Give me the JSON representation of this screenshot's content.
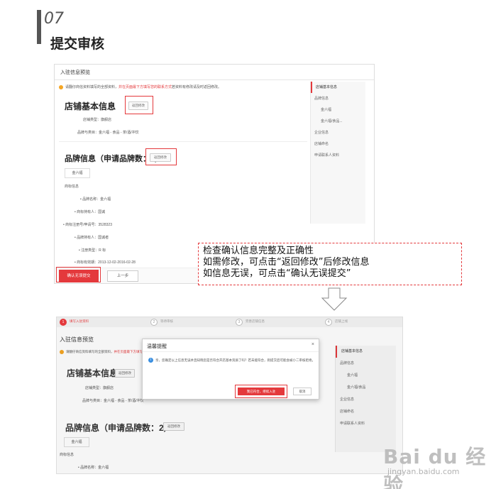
{
  "step": {
    "number": "07",
    "title": "提交审核"
  },
  "shot1": {
    "header": "入驻信息预览",
    "notice_pre": "请翻仔商信资料填写的全部资料，",
    "notice_red": "并在页面最下方填写您的联系方式",
    "notice_post": "若资料有修改请及时返回修改。",
    "store_title": "店铺基本信息",
    "back_edit": "返回修改",
    "store_type": "店铺类型：旗舰店",
    "store_category": "品牌与类目：金六福 - 食品 - 茶/酒/冲饮",
    "brand_title": "品牌信息（申请品牌数：2）",
    "brand_tag": "金六福",
    "trademark_label": "商标信息",
    "brand_name": "• 品牌名称：金六福",
    "trademark_owner": "• 商标持有人：国诚",
    "reg_no": "• 商标注册号/申请号：3528323",
    "holder": "• 品牌持有人：国诚者",
    "reg_type": "• 注册类型：R 标",
    "validity": "• 商标有效期：2013-12-02-2016-02-28",
    "confirm": "确认无误提交",
    "prev": "上一步",
    "side": [
      {
        "label": "店铺基本信息",
        "sub": false,
        "active": true
      },
      {
        "label": "品牌信息",
        "sub": false,
        "active": false
      },
      {
        "label": "金六福",
        "sub": true,
        "active": false
      },
      {
        "label": "金六福/食品...",
        "sub": true,
        "active": false
      },
      {
        "label": "企业信息",
        "sub": false,
        "active": false
      },
      {
        "label": "店铺命名",
        "sub": false,
        "active": false
      },
      {
        "label": "申请联系人资料",
        "sub": false,
        "active": false
      }
    ]
  },
  "callout": {
    "line1": "检查确认信息完整及正确性",
    "line2": "如需修改，可点击“返回修改”后修改信息",
    "line3": "如信息无误，可点击“确认无误提交”"
  },
  "shot2": {
    "steps": [
      "填写入驻资料",
      "等待审核",
      "完善店铺信息",
      "店铺上线"
    ],
    "title": "入驻信息预览",
    "notice_pre": "请翻仔商信资料填写的全部资料，",
    "notice_red": "并在页面最下方填写您",
    "store_title": "店铺基本信息",
    "back_edit": "返回修改",
    "store_type": "店铺类型：旗舰店",
    "store_category": "品牌与类目：金六福 - 食品 - 茶/酒/冲饮",
    "brand_title": "品牌信息（申请品牌数：2）",
    "brand_tag": "金六福",
    "trademark_label": "商标信息",
    "brand_name": "• 品牌名称：金六福",
    "side": [
      {
        "label": "店铺基本信息",
        "sub": false,
        "active": true
      },
      {
        "label": "品牌信息",
        "sub": false,
        "active": false
      },
      {
        "label": "金六福",
        "sub": true,
        "active": false
      },
      {
        "label": "金六福/食品",
        "sub": true,
        "active": false
      },
      {
        "label": "企业信息",
        "sub": false,
        "active": false
      },
      {
        "label": "店铺命名",
        "sub": false,
        "active": false
      },
      {
        "label": "申请联系人资料",
        "sub": false,
        "active": false
      }
    ],
    "modal": {
      "title": "温馨提醒",
      "close": "×",
      "body": "亲，您确定以上信息无误并且知晓您是否符合开店基本资质了吗？若未能符合，则提交后可能会被小二审核拒绝。",
      "ok": "我已符合，继续入驻",
      "cancel": "取消"
    }
  },
  "watermark": {
    "logo": "Bai du 经验",
    "sub": "jingyan.baidu.com"
  }
}
